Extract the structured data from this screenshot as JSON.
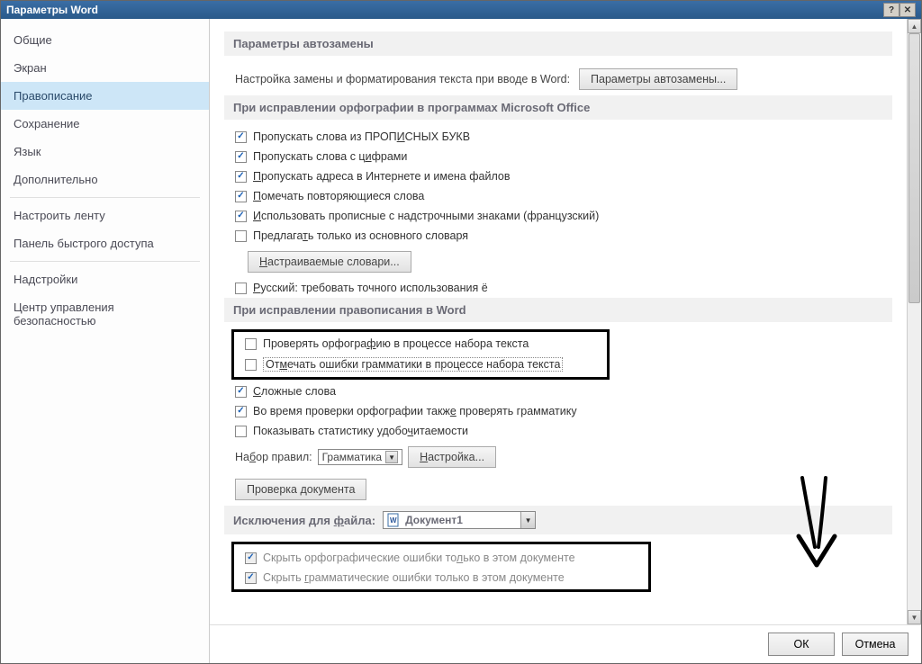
{
  "title": "Параметры Word",
  "sidebar": {
    "items": [
      {
        "label": "Общие"
      },
      {
        "label": "Экран"
      },
      {
        "label": "Правописание",
        "selected": true
      },
      {
        "label": "Сохранение"
      },
      {
        "label": "Язык"
      },
      {
        "label": "Дополнительно"
      },
      {
        "label": "Настроить ленту"
      },
      {
        "label": "Панель быстрого доступа"
      },
      {
        "label": "Надстройки"
      },
      {
        "label": "Центр управления безопасностью"
      }
    ]
  },
  "sections": {
    "autocorrect": {
      "header": "Параметры автозамены",
      "desc": "Настройка замены и форматирования текста при вводе в Word:",
      "button": "Параметры автозамены..."
    },
    "office_spell": {
      "header": "При исправлении орфографии в программах Microsoft Office",
      "checks": {
        "uppercase": {
          "pre": "Пропускать слова из ПРОП",
          "m": "И",
          "post": "СНЫХ БУКВ",
          "checked": true
        },
        "numbers": {
          "pre": "Пропускать слова с ц",
          "m": "и",
          "post": "фрами",
          "checked": true
        },
        "internet": {
          "pre": "",
          "m": "П",
          "post": "ропускать адреса в Интернете и имена файлов",
          "checked": true
        },
        "repeats": {
          "pre": "",
          "m": "П",
          "post": "омечать повторяющиеся слова",
          "checked": true
        },
        "french": {
          "pre": "",
          "m": "И",
          "post": "спользовать прописные с надстрочными знаками (французский)",
          "checked": true
        },
        "maindict": {
          "pre": "Предлага",
          "m": "т",
          "post": "ь только из основного словаря",
          "checked": false
        }
      },
      "dict_button": {
        "pre": "",
        "m": "Н",
        "post": "астраиваемые словари..."
      },
      "ru_e": {
        "pre": "",
        "m": "Р",
        "post": "усский: требовать точного использования ё",
        "checked": false
      }
    },
    "word_spell": {
      "header": "При исправлении правописания в Word",
      "check_spelling": {
        "pre": "Проверять орфогра",
        "m": "ф",
        "post": "ию в процессе набора текста",
        "checked": false
      },
      "check_grammar": {
        "pre": "От",
        "m": "м",
        "post": "ечать ошибки грамматики в процессе набора текста",
        "checked": false
      },
      "complex": {
        "pre": "",
        "m": "С",
        "post": "ложные слова",
        "checked": true
      },
      "with_grammar": {
        "pre": "Во время проверки орфографии такж",
        "m": "е",
        "post": " проверять грамматику",
        "checked": true
      },
      "readability": {
        "pre": "Показывать статистику удобо",
        "m": "ч",
        "post": "итаемости",
        "checked": false
      },
      "ruleset_label": {
        "pre": "На",
        "m": "б",
        "post": "ор правил:"
      },
      "ruleset_value": "Грамматика",
      "settings_btn": {
        "pre": "",
        "m": "Н",
        "post": "астройка..."
      },
      "recheck_btn": "Проверка документа"
    },
    "exceptions": {
      "header_pre": "Исключения для ",
      "header_m": "ф",
      "header_post": "айла:",
      "file": "Документ1",
      "hide_spell": {
        "pre": "Скрыть орфографические ошибки то",
        "m": "л",
        "post": "ько в этом документе",
        "checked": true
      },
      "hide_grammar": {
        "pre": "Скрыть ",
        "m": "г",
        "post": "рамматические ошибки только в этом документе",
        "checked": true
      }
    }
  },
  "footer": {
    "ok": "ОК",
    "cancel": "Отмена"
  }
}
